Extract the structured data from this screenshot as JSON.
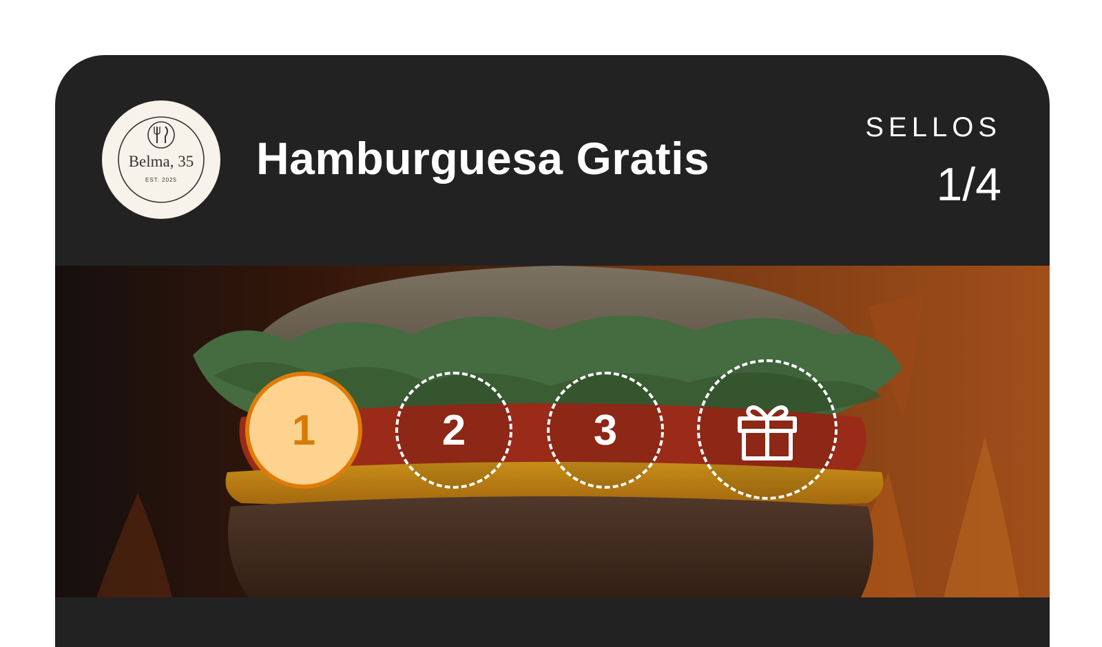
{
  "card": {
    "title": "Hamburguesa Gratis",
    "stamps_label": "SELLOS",
    "stamps_count": "1/4"
  },
  "logo": {
    "name": "Belma, 35",
    "subtitle": "EST. 2025",
    "icon": "fork-knife-icon"
  },
  "stamps": [
    {
      "label": "1",
      "state": "filled"
    },
    {
      "label": "2",
      "state": "empty"
    },
    {
      "label": "3",
      "state": "empty"
    },
    {
      "label": "",
      "state": "reward",
      "icon": "gift-icon"
    }
  ],
  "colors": {
    "card_bg": "#222222",
    "stamp_fill": "#fdd38f",
    "stamp_border": "#e07b08"
  }
}
